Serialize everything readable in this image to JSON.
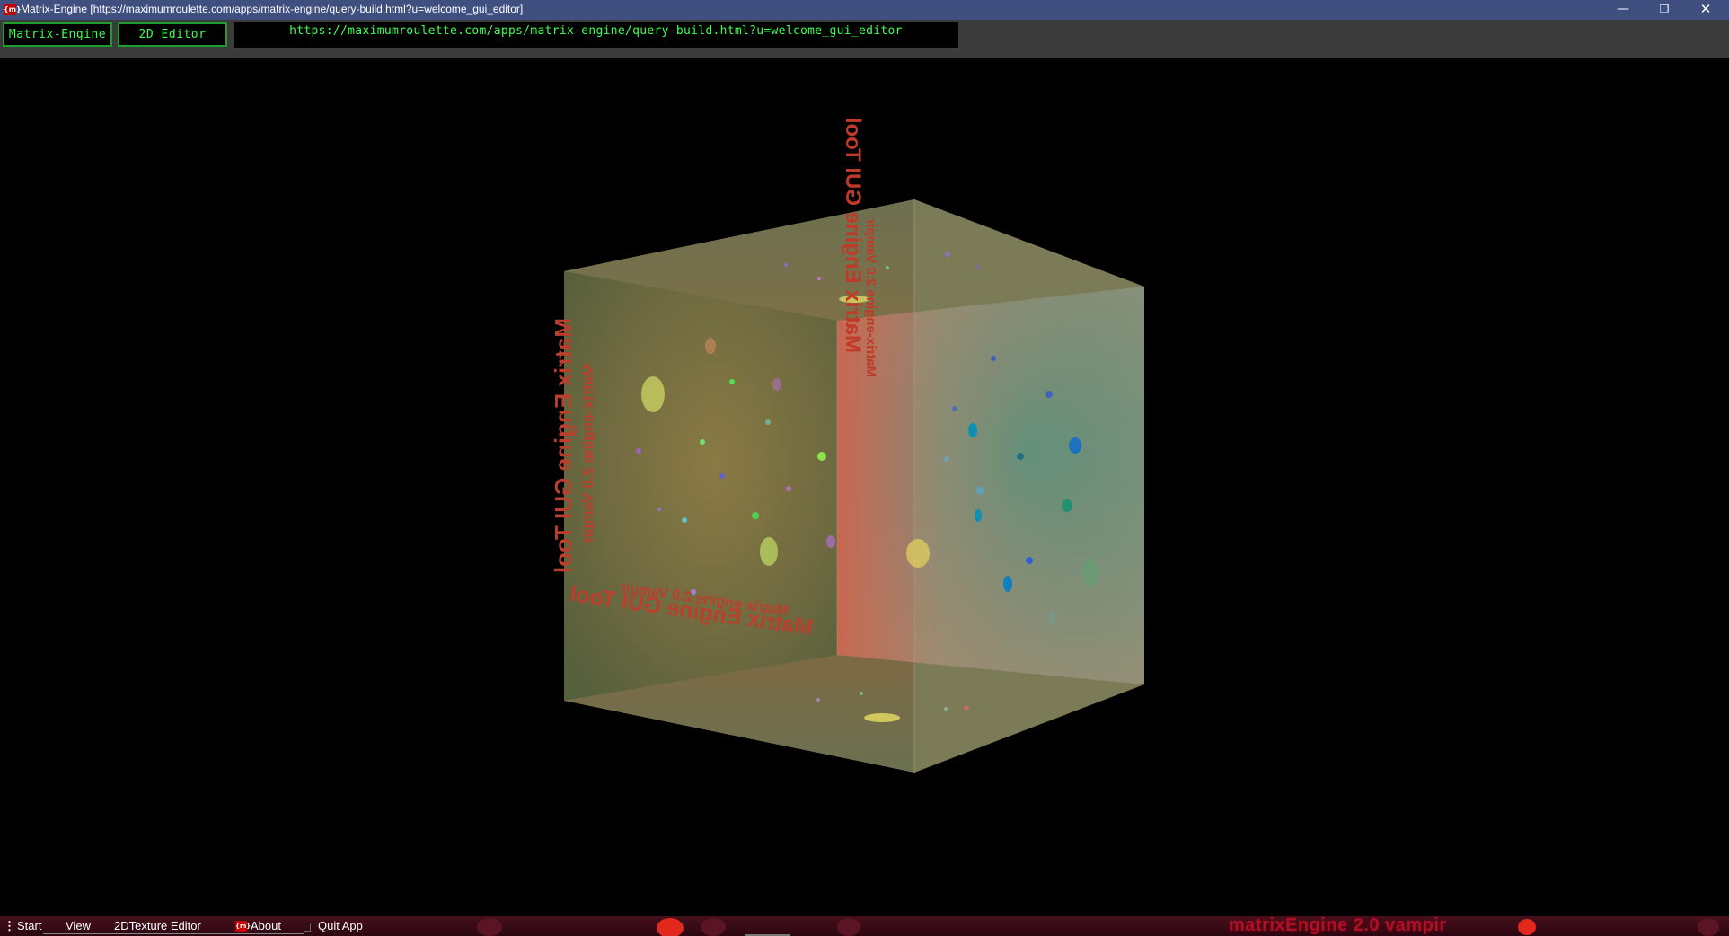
{
  "window": {
    "icon_text": "{m}",
    "title": "Matrix-Engine [https://maximumroulette.com/apps/matrix-engine/query-build.html?u=welcome_gui_editor]",
    "controls": {
      "minimize": "—",
      "maximize": "❐",
      "close": "✕"
    }
  },
  "toolbar": {
    "matrix_engine_label": "Matrix-Engine",
    "editor_2d_label": "2D Editor",
    "url": "https://maximumroulette.com/apps/matrix-engine/query-build.html?u=welcome_gui_editor"
  },
  "scene": {
    "faces": {
      "left_title": "Matrix Engine GUI Tool",
      "left_subtitle": "Matrix-engine 2.0 Vampir",
      "bottom_title": "Matrix Engine GUI Tool",
      "bottom_subtitle": "Matrix-engine 2.0 Vampir",
      "right_title": "Matrix Engine GUI Tool",
      "right_subtitle": "Matrix-engine 2.0 Vampir"
    },
    "colors": {
      "background": "#000000",
      "cube_tint": "#a6a070",
      "text": "#c0392b"
    }
  },
  "taskbar": {
    "menu_dots": "⋮",
    "start_label": "Start",
    "view_label": "View",
    "texture_editor_label": "2DTexture Editor",
    "about_icon_text": "{m}",
    "about_label": "About",
    "quit_label": "Quit App",
    "brand_text": "matrixEngine 2.0 vampir"
  },
  "colors": {
    "titlebar": "#3f4f80",
    "toolbar": "#3b3b3b",
    "accent_green": "#3dff52",
    "taskbar": "#45101c",
    "brand_red": "#c3122a"
  }
}
